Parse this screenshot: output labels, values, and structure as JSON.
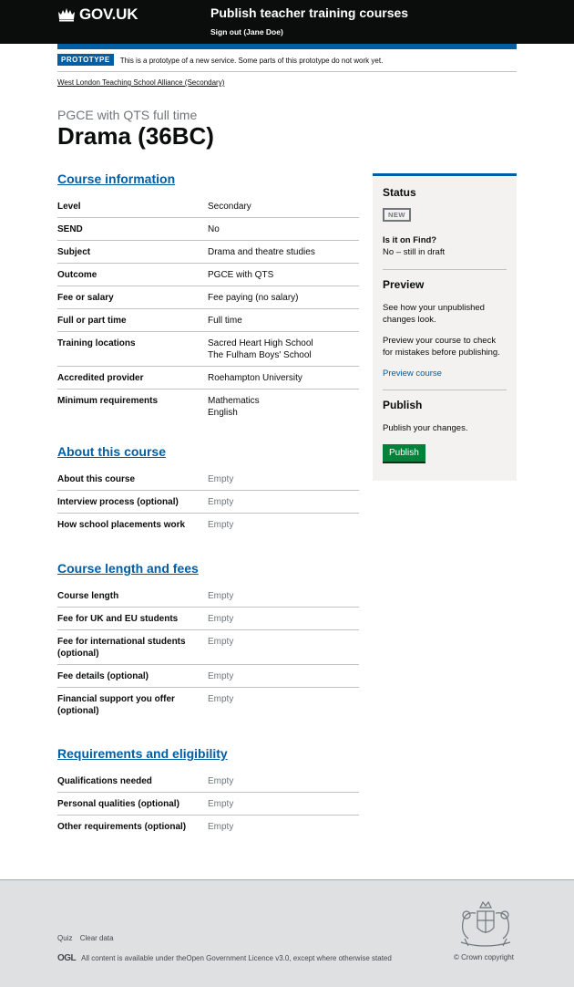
{
  "header": {
    "logo_text": "GOV.UK",
    "service_name": "Publish teacher training courses",
    "signout": "Sign out (Jane Doe)"
  },
  "phase": {
    "tag": "PROTOTYPE",
    "text": "This is a prototype of a new service. Some parts of this prototype do not work yet."
  },
  "org_link": "West London Teaching School Alliance (Secondary)",
  "page": {
    "caption": "PGCE with QTS full time",
    "title": "Drama (36BC)"
  },
  "course_info": {
    "heading": "Course information",
    "rows": [
      {
        "key": "Level",
        "value": "Secondary"
      },
      {
        "key": "SEND",
        "value": "No"
      },
      {
        "key": "Subject",
        "value": "Drama and theatre studies"
      },
      {
        "key": "Outcome",
        "value": "PGCE with QTS"
      },
      {
        "key": "Fee or salary",
        "value": "Fee paying (no salary)"
      },
      {
        "key": "Full or part time",
        "value": "Full time"
      },
      {
        "key": "Training locations",
        "value": "Sacred Heart High School",
        "value2": "The Fulham Boys' School"
      },
      {
        "key": "Accredited provider",
        "value": "Roehampton University"
      },
      {
        "key": "Minimum requirements",
        "value": "Mathematics",
        "value2": "English"
      }
    ]
  },
  "about": {
    "heading": "About this course",
    "rows": [
      {
        "key": "About this course",
        "value": "Empty"
      },
      {
        "key": "Interview process (optional)",
        "value": "Empty"
      },
      {
        "key": "How school placements work",
        "value": "Empty"
      }
    ]
  },
  "length_fees": {
    "heading": "Course length and fees",
    "rows": [
      {
        "key": "Course length",
        "value": "Empty"
      },
      {
        "key": "Fee for UK and EU students",
        "value": "Empty"
      },
      {
        "key": "Fee for international students (optional)",
        "value": "Empty"
      },
      {
        "key": "Fee details (optional)",
        "value": "Empty"
      },
      {
        "key": "Financial support you offer (optional)",
        "value": "Empty"
      }
    ]
  },
  "requirements": {
    "heading": "Requirements and eligibility",
    "rows": [
      {
        "key": "Qualifications needed",
        "value": "Empty"
      },
      {
        "key": "Personal qualities (optional)",
        "value": "Empty"
      },
      {
        "key": "Other requirements (optional)",
        "value": "Empty"
      }
    ]
  },
  "sidebar": {
    "status_heading": "Status",
    "status_tag": "NEW",
    "find_label": "Is it on Find?",
    "find_value": "No – still in draft",
    "preview_heading": "Preview",
    "preview_text1": "See how your unpublished changes look.",
    "preview_text2": "Preview your course to check for mistakes before publishing.",
    "preview_link": "Preview course",
    "publish_heading": "Publish",
    "publish_text": "Publish your changes.",
    "publish_button": "Publish"
  },
  "footer": {
    "links": [
      "Quiz",
      "Clear data"
    ],
    "ogl_logo": "OGL",
    "licence_prefix": "All content is available under the ",
    "licence_link": "Open Government Licence v3.0",
    "licence_suffix": ", except where otherwise stated",
    "copyright": "© Crown copyright"
  }
}
